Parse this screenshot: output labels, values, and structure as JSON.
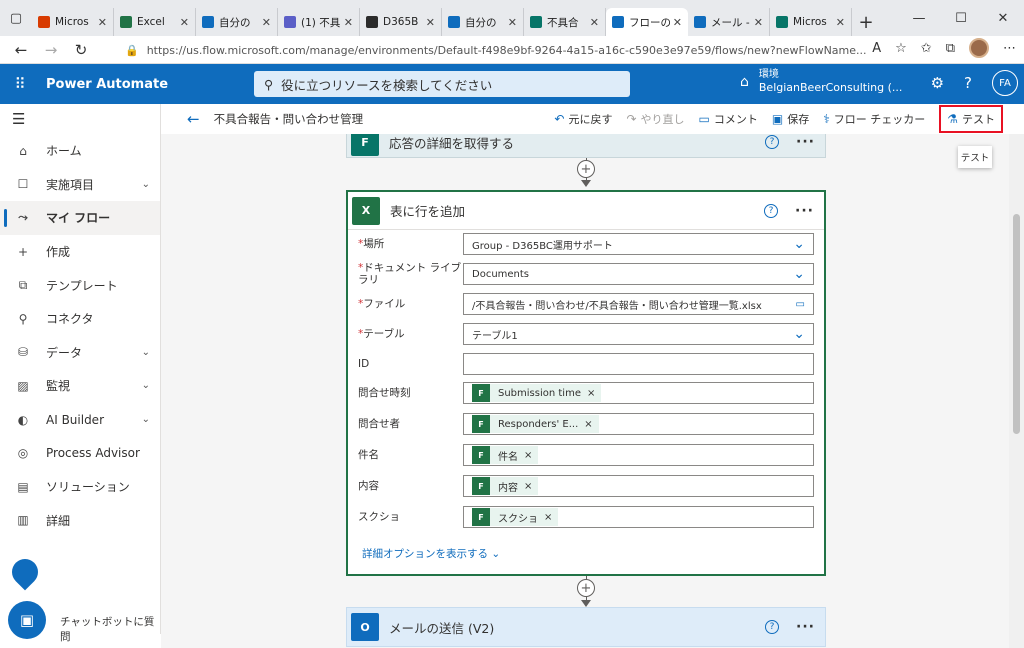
{
  "browser": {
    "tabs": [
      {
        "title": "Micros",
        "favicon": "office-icon",
        "color": "#d83b01",
        "active": false
      },
      {
        "title": "Excel",
        "favicon": "excel-icon",
        "color": "#217346",
        "active": false
      },
      {
        "title": "自分の",
        "favicon": "onedrive-icon",
        "color": "#0f6cbd",
        "active": false
      },
      {
        "title": "(1) 不具",
        "favicon": "teams-icon",
        "color": "#5b5fc7",
        "active": false
      },
      {
        "title": "D365B",
        "favicon": "dynamics-icon",
        "color": "#2b2b2b",
        "active": false
      },
      {
        "title": "自分の",
        "favicon": "onedrive-icon",
        "color": "#0f6cbd",
        "active": false
      },
      {
        "title": "不具合",
        "favicon": "forms-icon",
        "color": "#077568",
        "active": false
      },
      {
        "title": "フローの",
        "favicon": "power-automate-icon",
        "color": "#0f6cbd",
        "active": true
      },
      {
        "title": "メール -",
        "favicon": "outlook-icon",
        "color": "#0f6cbd",
        "active": false
      },
      {
        "title": "Micros",
        "favicon": "forms-icon",
        "color": "#077568",
        "active": false
      }
    ],
    "url": "https://us.flow.microsoft.com/manage/environments/Default-f498e9bf-9264-4a15-a16c-c590e3e97e59/flows/new?newFlowName..."
  },
  "header": {
    "app_name": "Power Automate",
    "search_placeholder": "役に立つリソースを検索してください",
    "env_label": "環境",
    "env_value": "BelgianBeerConsulting (...",
    "avatar_initials": "FA"
  },
  "sidebar": {
    "items": [
      {
        "label": "ホーム",
        "icon": "home-icon",
        "glyph": "⌂",
        "chevron": false,
        "selected": false
      },
      {
        "label": "実施項目",
        "icon": "clipboard-icon",
        "glyph": "☐",
        "chevron": true,
        "selected": false
      },
      {
        "label": "マイ フロー",
        "icon": "flow-icon",
        "glyph": "⤳",
        "chevron": false,
        "selected": true
      },
      {
        "label": "作成",
        "icon": "plus-icon",
        "glyph": "+",
        "chevron": false,
        "selected": false
      },
      {
        "label": "テンプレート",
        "icon": "template-icon",
        "glyph": "⧉",
        "chevron": false,
        "selected": false
      },
      {
        "label": "コネクタ",
        "icon": "connector-icon",
        "glyph": "⚲",
        "chevron": false,
        "selected": false
      },
      {
        "label": "データ",
        "icon": "database-icon",
        "glyph": "⛁",
        "chevron": true,
        "selected": false
      },
      {
        "label": "監視",
        "icon": "monitor-icon",
        "glyph": "▨",
        "chevron": true,
        "selected": false
      },
      {
        "label": "AI Builder",
        "icon": "ai-builder-icon",
        "glyph": "◐",
        "chevron": true,
        "selected": false
      },
      {
        "label": "Process Advisor",
        "icon": "process-advisor-icon",
        "glyph": "◎",
        "chevron": false,
        "selected": false
      },
      {
        "label": "ソリューション",
        "icon": "solution-icon",
        "glyph": "▤",
        "chevron": false,
        "selected": false
      },
      {
        "label": "詳細",
        "icon": "book-icon",
        "glyph": "▥",
        "chevron": false,
        "selected": false
      }
    ],
    "chatbot_label": "チャットボットに質問"
  },
  "command_bar": {
    "flow_name": "不具合報告・問い合わせ管理",
    "undo": "元に戻す",
    "redo": "やり直し",
    "comment": "コメント",
    "save": "保存",
    "flow_checker": "フロー チェッカー",
    "test": "テスト",
    "tooltip": "テスト"
  },
  "canvas": {
    "prev_card_title": "応答の詳細を取得する",
    "main_card": {
      "title": "表に行を追加",
      "fields": [
        {
          "label": "場所",
          "required": true,
          "value": "Group - D365BC運用サポート",
          "dropdown": true,
          "token": false
        },
        {
          "label": "ドキュメント ライブラリ",
          "required": true,
          "value": "Documents",
          "dropdown": true,
          "token": false
        },
        {
          "label": "ファイル",
          "required": true,
          "value": "/不具合報告・問い合わせ/不具合報告・問い合わせ管理一覧.xlsx",
          "dropdown": false,
          "folder": true,
          "token": false
        },
        {
          "label": "テーブル",
          "required": true,
          "value": "テーブル1",
          "dropdown": true,
          "token": false
        },
        {
          "label": "ID",
          "required": false,
          "value": "",
          "dropdown": false,
          "token": false
        },
        {
          "label": "問合せ時刻",
          "required": false,
          "value": "Submission time",
          "dropdown": false,
          "token": true
        },
        {
          "label": "問合せ者",
          "required": false,
          "value": "Responders' E...",
          "dropdown": false,
          "token": true
        },
        {
          "label": "件名",
          "required": false,
          "value": "件名",
          "dropdown": false,
          "token": true
        },
        {
          "label": "内容",
          "required": false,
          "value": "内容",
          "dropdown": false,
          "token": true
        },
        {
          "label": "スクショ",
          "required": false,
          "value": "スクショ",
          "dropdown": false,
          "token": true
        }
      ],
      "advanced_options": "詳細オプションを表示する"
    },
    "next_card_title": "メールの送信 (V2)"
  }
}
